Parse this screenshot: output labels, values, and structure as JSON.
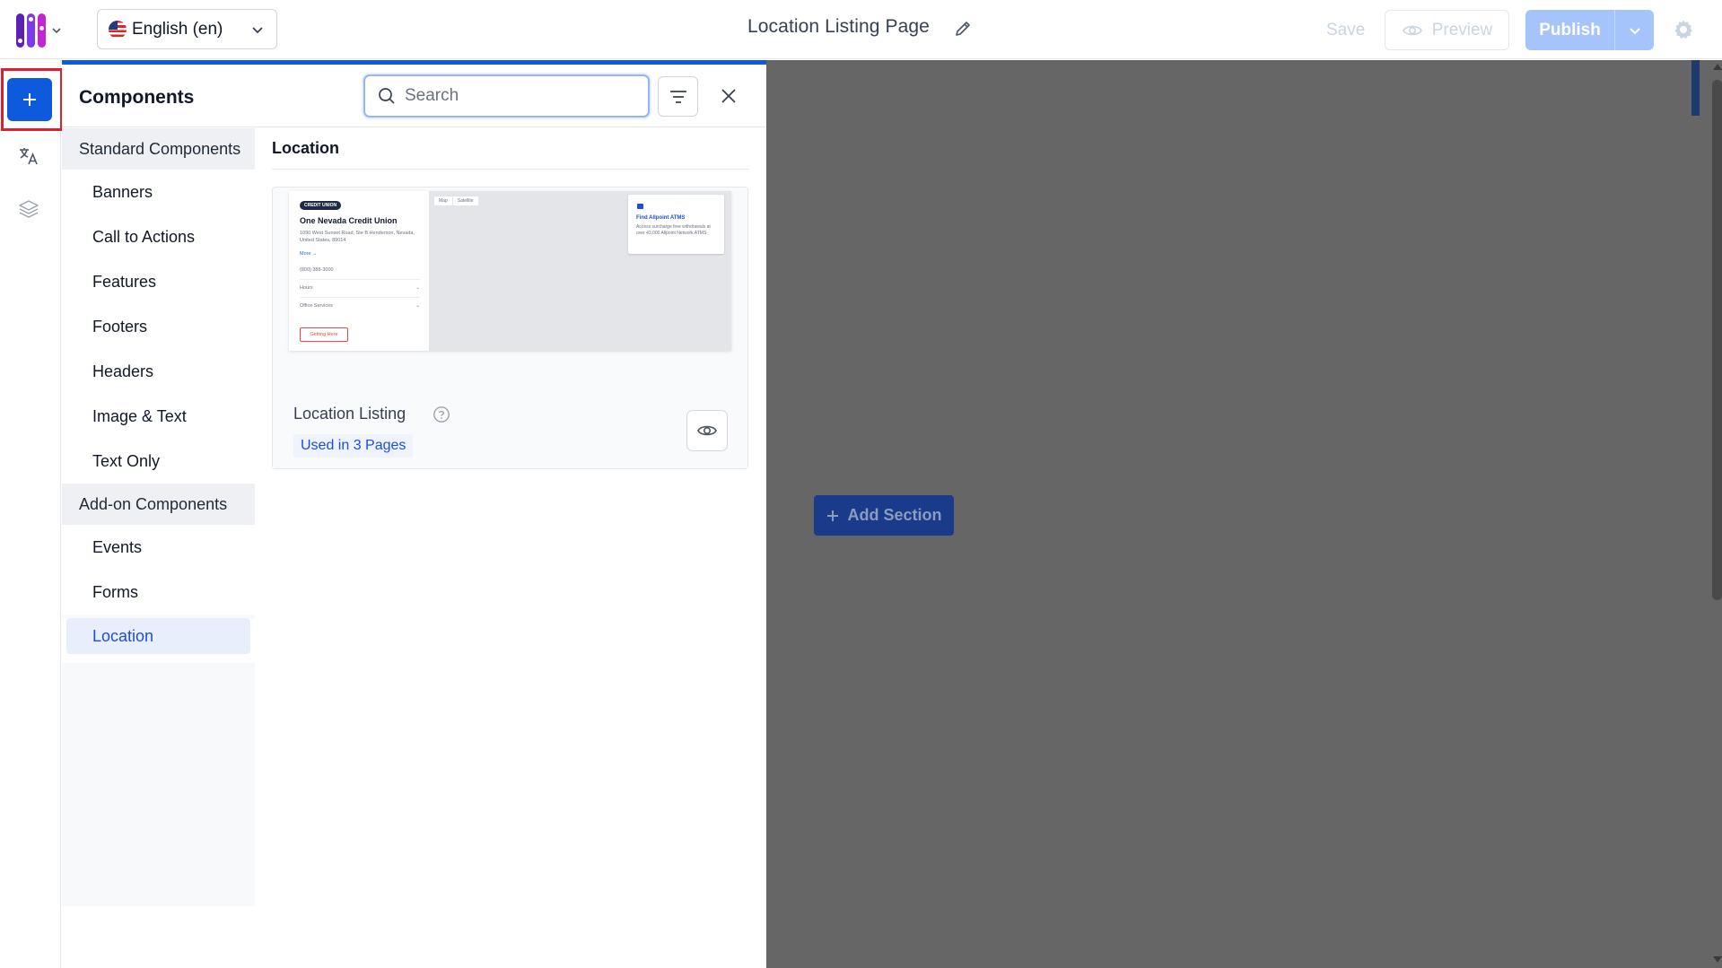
{
  "header": {
    "language": "English (en)",
    "page_title": "Location Listing Page",
    "save_label": "Save",
    "preview_label": "Preview",
    "publish_label": "Publish"
  },
  "rail": {
    "icons": [
      "plus-icon",
      "translate-icon",
      "layers-icon"
    ]
  },
  "panel": {
    "title": "Components",
    "search_placeholder": "Search",
    "categories": {
      "standard_title": "Standard Components",
      "standard": [
        "Banners",
        "Call to Actions",
        "Features",
        "Footers",
        "Headers",
        "Image & Text",
        "Text Only"
      ],
      "addon_title": "Add-on Components",
      "addon": [
        "Events",
        "Forms",
        "Location"
      ]
    },
    "selected_category": "Location",
    "section_title": "Location",
    "card": {
      "name": "Location Listing",
      "usage": "Used in 3 Pages",
      "thumbnail": {
        "badge": "CREDIT UNION",
        "org_name": "One Nevada Credit Union",
        "address": "1090 West Sunset Road, Ste B Henderson, Nevada, United States, 89014",
        "more": "More →",
        "phone": "(800) 388-3000",
        "row1": "Hours",
        "row2": "Office Services",
        "button": "Getting Here",
        "map_tab1": "Map",
        "map_tab2": "Satellite",
        "atm_title": "Find Allpoint ATMS",
        "atm_text": "Access surcharge free withdrawals at over 43,000 Allpoint Network ATMS"
      }
    }
  },
  "canvas": {
    "add_section_label": "Add Section"
  },
  "colors": {
    "brand_blue": "#0d5bdc",
    "publish_disabled": "#a5c4fb",
    "highlight_red": "#e11d2e",
    "canvas_gray": "#666666"
  }
}
